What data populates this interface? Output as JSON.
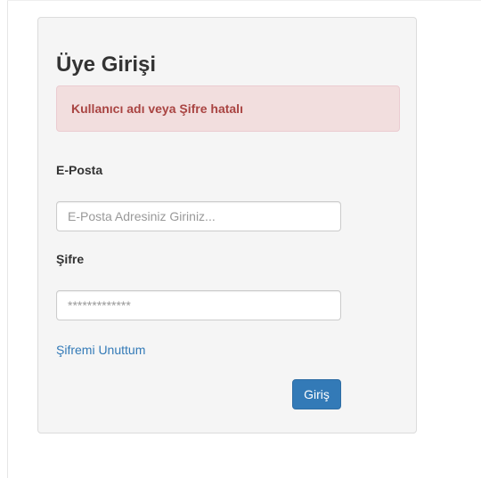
{
  "login": {
    "title": "Üye Girişi",
    "error_message": "Kullanıcı adı veya Şifre hatalı",
    "email_label": "E-Posta",
    "email_placeholder": "E-Posta Adresiniz Giriniz...",
    "email_value": "",
    "password_label": "Şifre",
    "password_placeholder": "*************",
    "password_value": "",
    "forgot_password_link": "Şifremi Unuttum",
    "submit_label": "Giriş"
  },
  "colors": {
    "panel_background": "#f5f5f5",
    "alert_background": "#f2dede",
    "alert_text": "#a94442",
    "link": "#337ab7",
    "primary_button": "#337ab7"
  }
}
